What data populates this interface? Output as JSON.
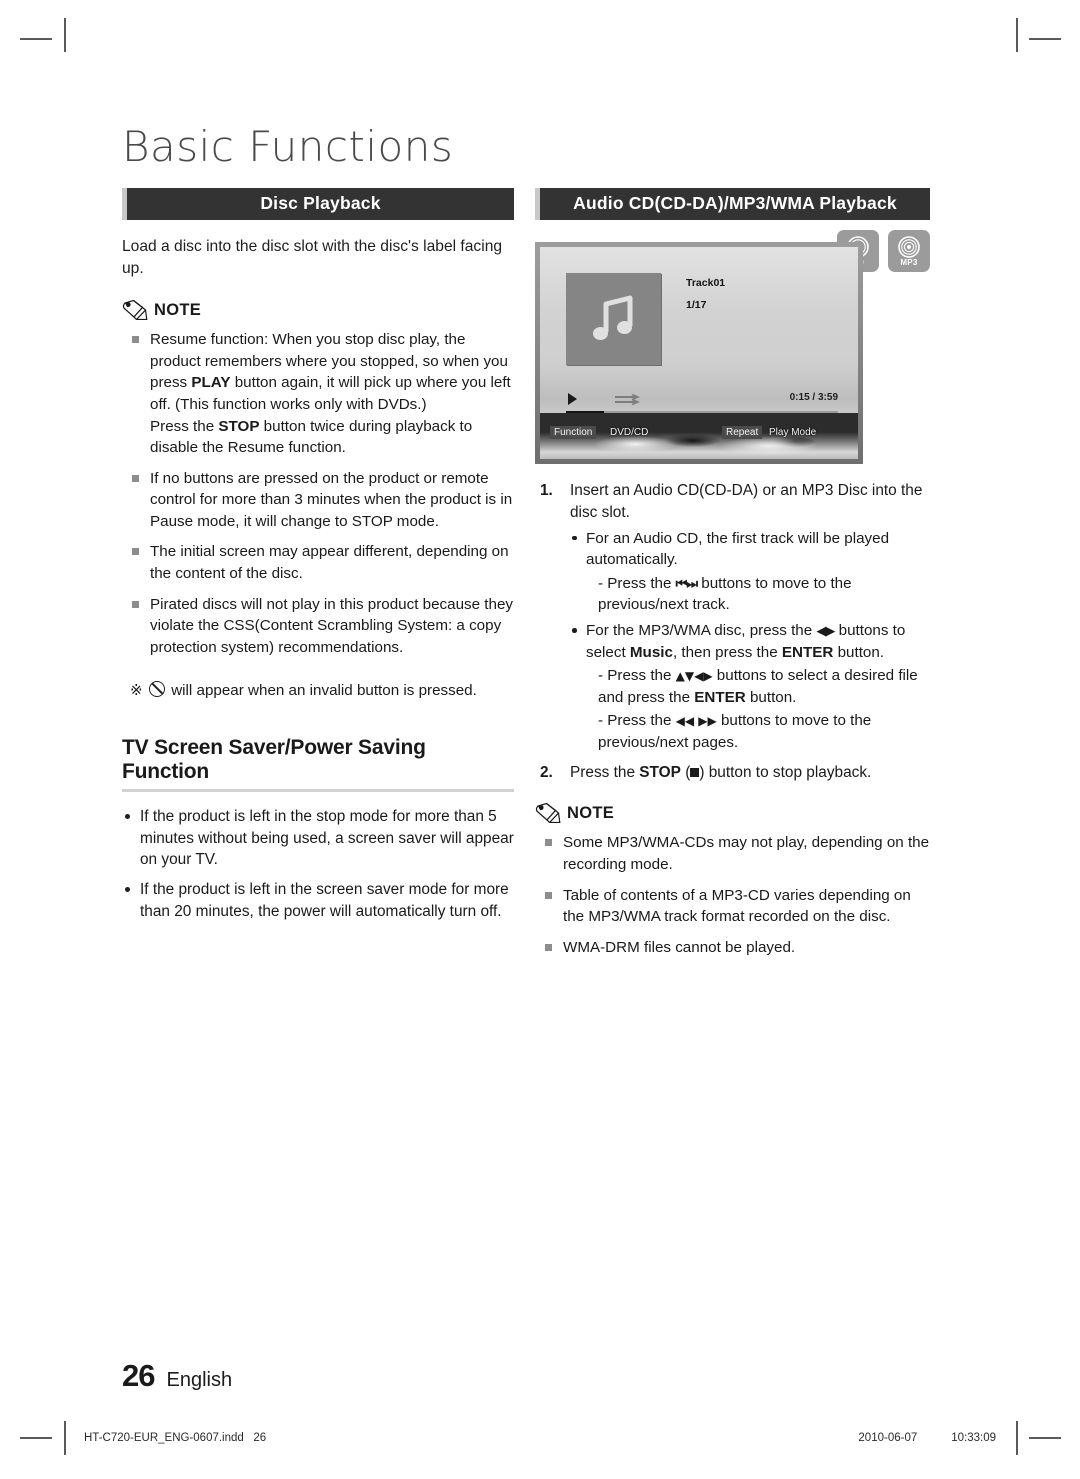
{
  "document": {
    "chapter_title": "Basic Functions",
    "page_number": "26",
    "language": "English"
  },
  "left_column": {
    "section_header": "Disc Playback",
    "intro_paragraph": "Load a disc into the disc slot with the disc's label facing up.",
    "note_label": "NOTE",
    "note_icon": "pencil-icon",
    "notes": [
      {
        "text_a": "Resume function: When you stop disc play, the product remembers where you stopped, so when you press ",
        "bold_a": "PLAY",
        "text_b": " button again, it will pick up where you left off. (This function works only with DVDs.)",
        "text_c": "Press the ",
        "bold_b": "STOP",
        "text_d": " button twice during playback to disable the Resume function."
      },
      {
        "text": "If no buttons are pressed on the product or remote control for more than 3 minutes when the product is in Pause mode, it will change to STOP mode."
      },
      {
        "text": "The initial screen may appear different, depending on the content of the disc."
      },
      {
        "text": "Pirated discs will not play in this product because they violate the CSS(Content Scrambling System: a copy protection system) recommendations."
      }
    ],
    "star_note": {
      "marker": "※",
      "icon": "prohibition-icon",
      "text": "will appear when an invalid button is pressed."
    },
    "subsection": {
      "heading": "TV Screen Saver/Power Saving Function",
      "bullets": [
        "If the product is left in the stop mode for more than 5 minutes without being used, a screen saver will appear on your TV.",
        "If the product is left in the screen saver mode for more than 20 minutes, the power will automatically turn off."
      ]
    }
  },
  "right_column": {
    "section_header": "Audio CD(CD-DA)/MP3/WMA Playback",
    "badges": [
      {
        "label": "CD",
        "icon": "disc-icon"
      },
      {
        "label": "MP3",
        "icon": "disc-icon"
      }
    ],
    "tv_screen": {
      "album_art_icon": "music-note-icon",
      "track_title": "Track01",
      "track_index": "1/17",
      "play_icon": "play-icon",
      "fast_forward_icon": "fast-forward-icon",
      "time_elapsed": "0:15",
      "time_separator": "/",
      "time_total": "3:59",
      "progress_percent": 14,
      "osd": {
        "function_label": "Function",
        "function_value": "DVD/CD",
        "repeat_label": "Repeat",
        "play_mode_label": "Play Mode"
      }
    },
    "steps": [
      {
        "num": "1.",
        "text": "Insert an Audio CD(CD-DA) or an MP3 Disc into the disc slot.",
        "bullets": [
          {
            "text": "For an Audio CD, the first track will be played automatically.",
            "dashes": [
              {
                "prefix": "- Press the ",
                "glyph": "⏮⏭",
                "glyph_name": "skip-prev-next-icon",
                "suffix": " buttons to move to the previous/next track."
              }
            ]
          },
          {
            "text_a": "For the MP3/WMA disc, press the ",
            "glyph": "◀▶",
            "glyph_name": "left-right-arrow-icon",
            "text_b": " buttons to select ",
            "bold_a": "Music",
            "text_c": ", then press the ",
            "bold_b": "ENTER",
            "text_d": " button.",
            "dashes": [
              {
                "prefix": "- Press the ",
                "glyph": "▲▼◀▶",
                "glyph_name": "dpad-arrows-icon",
                "middle": " buttons to select  a desired file and press the ",
                "bold": "ENTER",
                "suffix": " button."
              },
              {
                "prefix": "- Press the ",
                "glyph": "◀◀ ▶▶",
                "glyph_name": "rewind-fastforward-icon",
                "suffix": " buttons to move to the previous/next pages."
              }
            ]
          }
        ]
      },
      {
        "num": "2.",
        "text_a": "Press the ",
        "bold_a": "STOP",
        "text_b": " (",
        "glyph_name": "stop-square-icon",
        "text_c": ") button to stop playback."
      }
    ],
    "note_label": "NOTE",
    "note_icon": "pencil-icon",
    "notes": [
      "Some MP3/WMA-CDs may not play, depending on the recording mode.",
      "Table of contents of a MP3-CD varies depending on the MP3/WMA track format recorded on the disc.",
      "WMA-DRM files cannot be played."
    ]
  },
  "print_footer": {
    "file_name": "HT-C720-EUR_ENG-0607.indd",
    "file_page": "26",
    "date": "2010-06-07",
    "time": "10:33:09"
  },
  "colors": {
    "header_bar": "#333333",
    "header_bar_edge": "#c8c8c8",
    "badge_gray": "#9b9b9b",
    "rule_gray": "#d2d2d2"
  }
}
